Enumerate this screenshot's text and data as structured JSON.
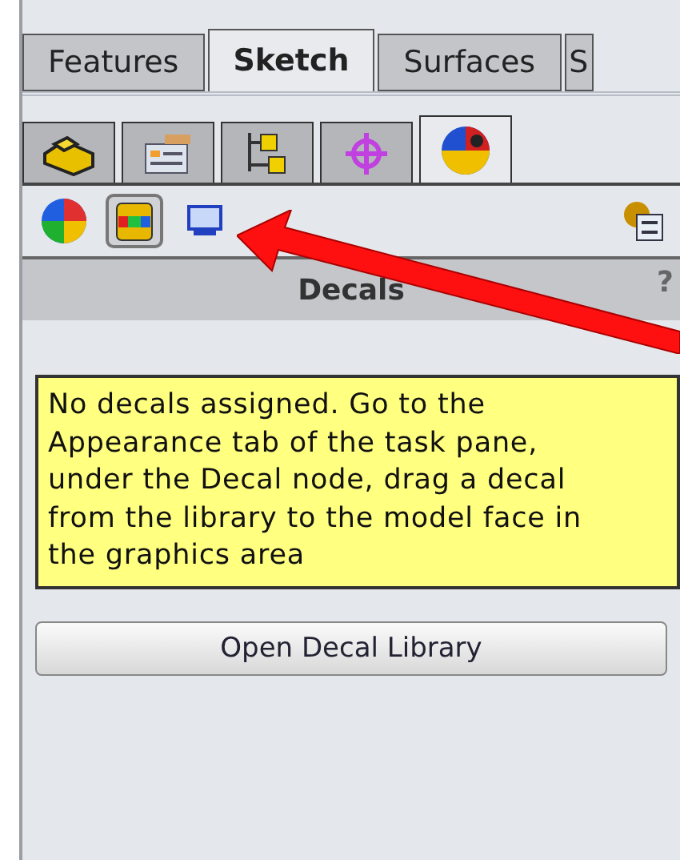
{
  "tabs": [
    {
      "label": "Features",
      "selected": false
    },
    {
      "label": "Sketch",
      "selected": true
    },
    {
      "label": "Surfaces",
      "selected": false
    },
    {
      "label": "S",
      "selected": false
    }
  ],
  "panel_tabs": [
    {
      "kind": "part",
      "selected": false
    },
    {
      "kind": "properties",
      "selected": false
    },
    {
      "kind": "config",
      "selected": false
    },
    {
      "kind": "target",
      "selected": false
    },
    {
      "kind": "appearance",
      "selected": true
    }
  ],
  "toolbar": [
    {
      "kind": "sphere",
      "selected": false
    },
    {
      "kind": "decal",
      "selected": true
    },
    {
      "kind": "scene",
      "selected": false
    }
  ],
  "header": {
    "title": "Decals",
    "help": "?"
  },
  "message": "No decals assigned. Go to the Appearance tab of the task pane, under the Decal node, drag a decal from the library to the model face in the graphics area",
  "button": "Open Decal Library"
}
